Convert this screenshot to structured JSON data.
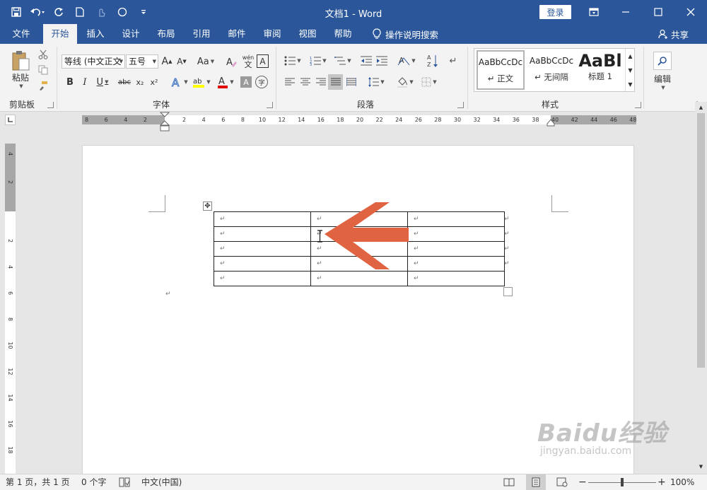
{
  "window": {
    "title": "文档1  -  Word",
    "login_label": "登录"
  },
  "tabs": [
    {
      "label": "文件"
    },
    {
      "label": "开始",
      "active": true
    },
    {
      "label": "插入"
    },
    {
      "label": "设计"
    },
    {
      "label": "布局"
    },
    {
      "label": "引用"
    },
    {
      "label": "邮件"
    },
    {
      "label": "审阅"
    },
    {
      "label": "视图"
    },
    {
      "label": "帮助"
    }
  ],
  "tell_me": "操作说明搜索",
  "share_label": "共享",
  "ribbon": {
    "clipboard": {
      "paste_label": "粘贴",
      "group_label": "剪贴板"
    },
    "font": {
      "font_name": "等线 (中文正文",
      "font_size": "五号",
      "change_case": "Aa",
      "phonetic": "wén",
      "phonetic_char": "文",
      "bold": "B",
      "italic": "I",
      "underline": "U",
      "strike": "abc",
      "subscript": "x₂",
      "superscript": "x²",
      "enclose": "字",
      "group_label": "字体"
    },
    "paragraph": {
      "group_label": "段落"
    },
    "styles": {
      "items": [
        {
          "sample": "AaBbCcDc",
          "name": "正文"
        },
        {
          "sample": "AaBbCcDc",
          "name": "无间隔"
        },
        {
          "sample": "AaBl",
          "name": "标题 1"
        }
      ],
      "group_label": "样式"
    },
    "editing": {
      "label": "编辑"
    }
  },
  "ruler": {
    "h_numbers": [
      "8",
      "6",
      "4",
      "2",
      "2",
      "4",
      "6",
      "8",
      "10",
      "12",
      "14",
      "16",
      "18",
      "20",
      "22",
      "24",
      "26",
      "28",
      "30",
      "32",
      "34",
      "36",
      "38",
      "40",
      "42",
      "44",
      "46",
      "48"
    ],
    "v_numbers": [
      "4",
      "2",
      "2",
      "4",
      "6",
      "8",
      "10",
      "12",
      "14",
      "16",
      "18"
    ]
  },
  "document": {
    "table": {
      "rows": 5,
      "cols": 3
    },
    "annotation": "arrow pointing at cursor in column 2, row 2"
  },
  "status": {
    "page": "第 1 页，共 1 页",
    "words": "0 个字",
    "language": "中文(中国)",
    "zoom": "100%"
  },
  "watermark": {
    "brand": "Baidu经验",
    "url": "jingyan.baidu.com"
  },
  "colors": {
    "brand": "#2b579a",
    "arrow": "#e06442"
  }
}
